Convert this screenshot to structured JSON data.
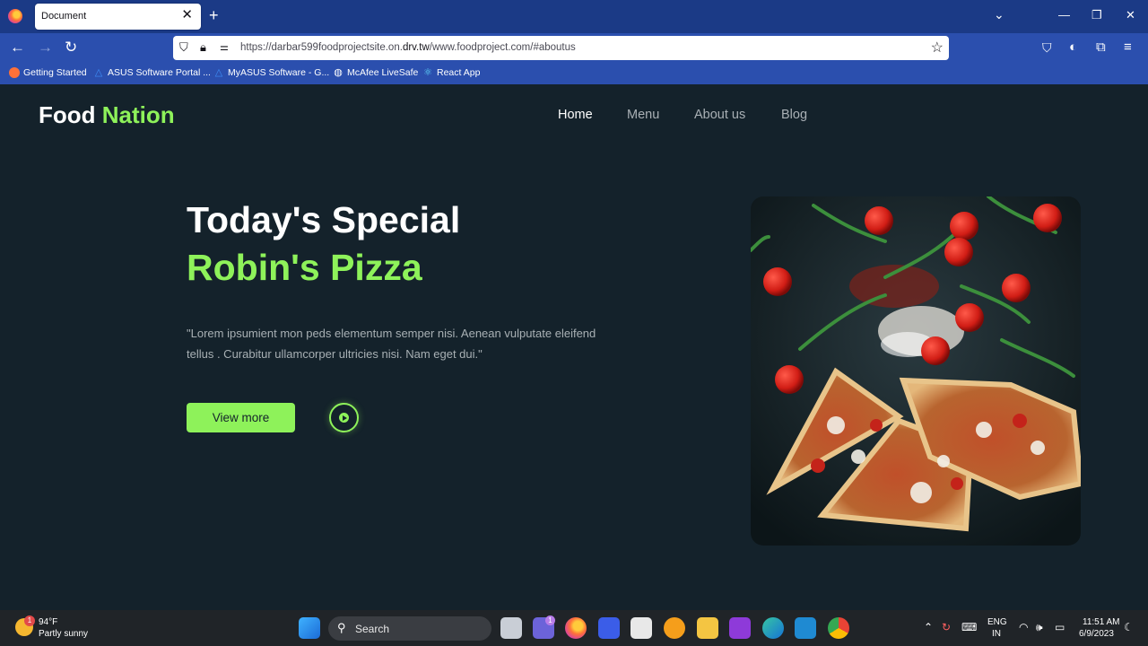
{
  "browser": {
    "tab_title": "Document",
    "url_host_prefix": "https://darbar599foodprojectsite.on.",
    "url_host_domain": "drv.tw",
    "url_path": "/www.foodproject.com/#aboutus",
    "bookmarks": [
      "Getting Started",
      "ASUS Software Portal ...",
      "MyASUS Software - G...",
      "McAfee LiveSafe",
      "React App"
    ]
  },
  "site": {
    "logo_word1": "Food",
    "logo_word2": "Nation",
    "nav": [
      "Home",
      "Menu",
      "About us",
      "Blog"
    ],
    "active_nav": "Home",
    "hero_title": "Today's Special",
    "hero_subtitle": "Robin's Pizza",
    "hero_text": "\"Lorem ipsumient mon peds elementum semper nisi. Aenean vulputate eleifend tellus . Curabitur ullamcorper ultricies nisi. Nam eget dui.\"",
    "cta_label": "View more",
    "accent_color": "#8ef25a",
    "background_color": "#14222b"
  },
  "taskbar": {
    "weather_temp": "94°F",
    "weather_desc": "Partly sunny",
    "weather_badge": "1",
    "search_label": "Search",
    "chat_badge": "1",
    "lang_line1": "ENG",
    "lang_line2": "IN",
    "time": "11:51 AM",
    "date": "6/9/2023"
  }
}
